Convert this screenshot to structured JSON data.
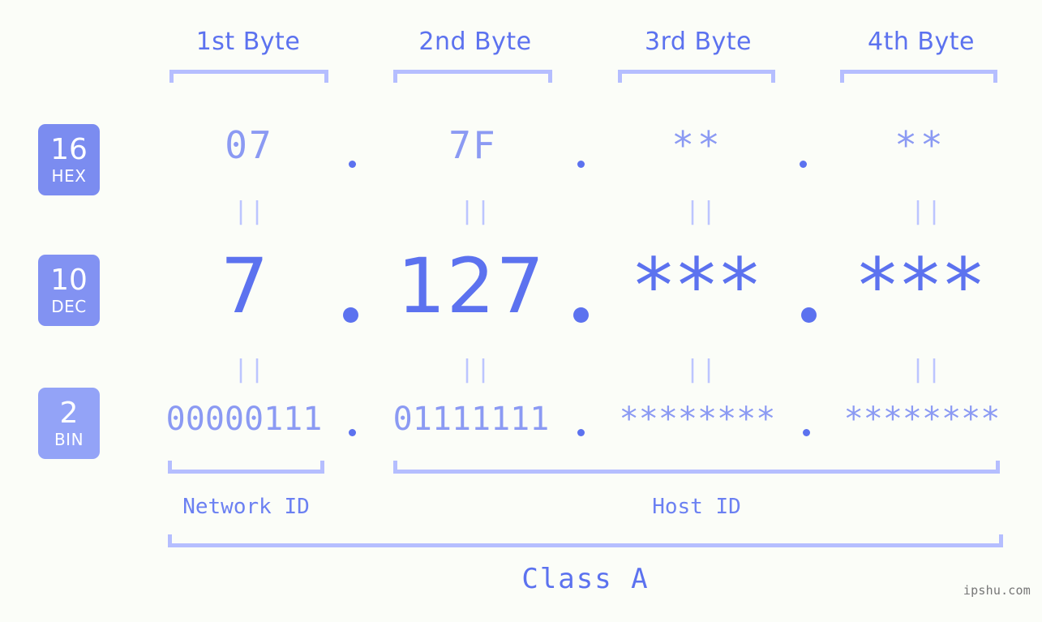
{
  "page": {
    "background_color": "#fbfdf8",
    "accent_color": "#5c72ef",
    "accent_light_color": "#8b9af3",
    "bracket_color": "#b5beff",
    "watermark": "ipshu.com"
  },
  "headers": [
    {
      "label": "1st Byte"
    },
    {
      "label": "2nd Byte"
    },
    {
      "label": "3rd Byte"
    },
    {
      "label": "4th Byte"
    }
  ],
  "bases": [
    {
      "number": "16",
      "name": "HEX",
      "color": "#7b8cf0"
    },
    {
      "number": "10",
      "name": "DEC",
      "color": "#8292f2"
    },
    {
      "number": "2",
      "name": "BIN",
      "color": "#93a3f7"
    }
  ],
  "rows": {
    "hex": {
      "values": [
        "07",
        "7F",
        "**",
        "**"
      ]
    },
    "dec": {
      "values": [
        "7",
        "127",
        "***",
        "***"
      ]
    },
    "bin": {
      "values": [
        "00000111",
        "01111111",
        "********",
        "********"
      ]
    }
  },
  "separators": {
    "equals_mark": "||",
    "dot": "."
  },
  "segments": [
    {
      "label": "Network ID"
    },
    {
      "label": "Host ID"
    }
  ],
  "class": {
    "label": "Class A"
  }
}
